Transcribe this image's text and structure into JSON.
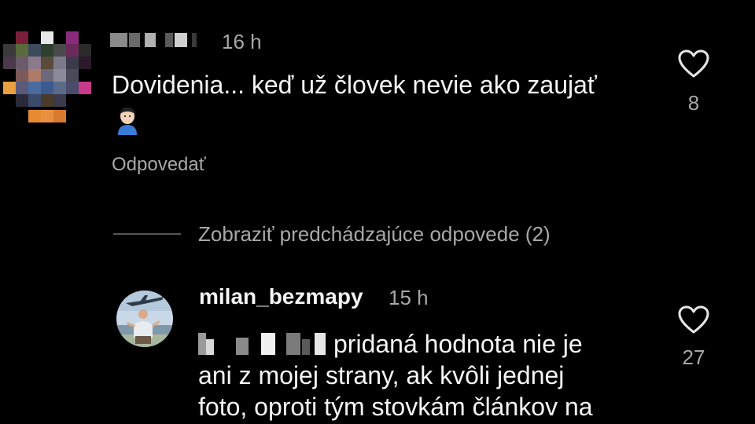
{
  "comment1": {
    "time": "16 h",
    "text": "Dovidenia... keď už človek nevie ako zaujať",
    "emoji_icon": "person-emoji-icon",
    "reply_label": "Odpovedať",
    "likes": "8"
  },
  "view_previous": {
    "label": "Zobraziť predchádzajúce odpovede (2)"
  },
  "comment2": {
    "username": "milan_bezmapy",
    "time": "15 h",
    "text_lines": [
      "pridaná hodnota nie je",
      "ani z mojej strany, ak kvôli jednej",
      "foto, oproti tým stovkám článkov na"
    ],
    "likes": "27"
  },
  "colors": {
    "background": "#000000",
    "primary_text": "#f5f5f5",
    "secondary_text": "#a8a8a8"
  }
}
